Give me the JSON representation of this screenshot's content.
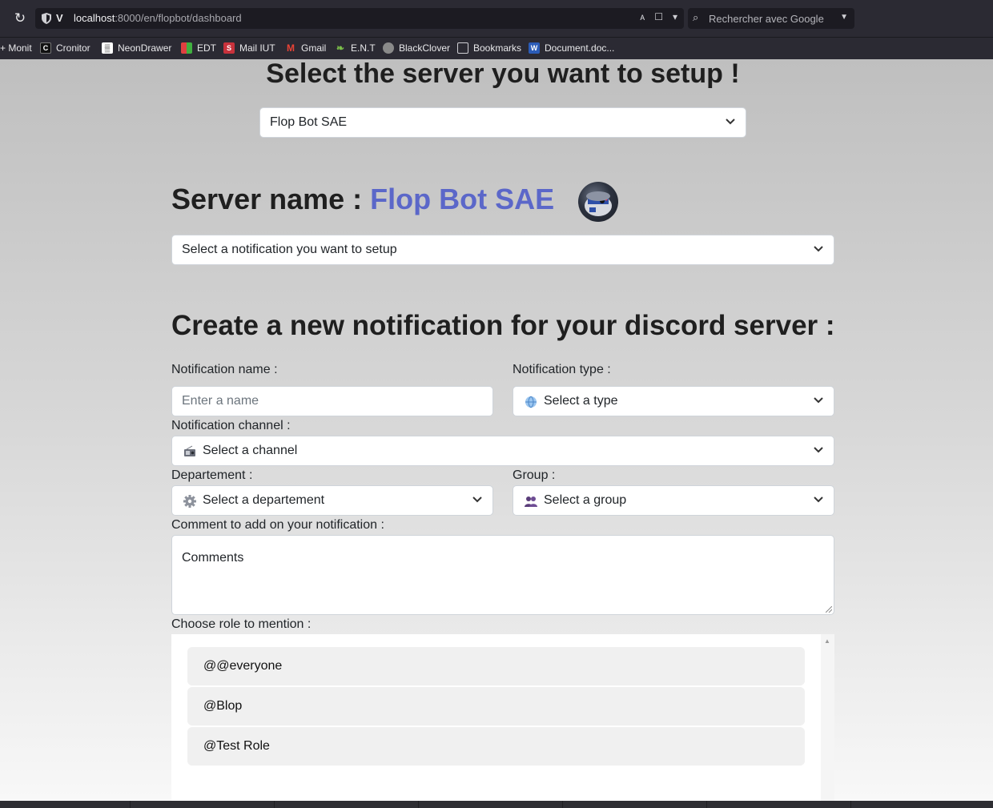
{
  "browser": {
    "url_host": "localhost",
    "url_rest": ":8000/en/flopbot/dashboard",
    "search_placeholder": "Rechercher avec Google",
    "bookmarks": [
      {
        "label": "+ Monit",
        "icon": "none"
      },
      {
        "label": "Cronitor",
        "icon": "cronitor-icon"
      },
      {
        "label": "NeonDrawer",
        "icon": "neondrawer-icon"
      },
      {
        "label": "EDT",
        "icon": "edt-icon"
      },
      {
        "label": "Mail IUT",
        "icon": "mail-iut-icon"
      },
      {
        "label": "Gmail",
        "icon": "gmail-icon"
      },
      {
        "label": "E.N.T",
        "icon": "ent-icon"
      },
      {
        "label": "BlackClover",
        "icon": "blackclover-icon"
      },
      {
        "label": "Bookmarks",
        "icon": "folder-icon"
      },
      {
        "label": "Document.doc...",
        "icon": "word-icon"
      }
    ]
  },
  "page": {
    "select_server_heading": "Select the server you want to setup !",
    "server_select_value": "Flop Bot SAE",
    "server_name_prefix": "Server name : ",
    "server_name": "Flop Bot SAE",
    "notification_select_value": "Select a notification you want to setup",
    "create_heading": "Create a new notification for your discord server :",
    "form": {
      "name_label": "Notification name :",
      "name_placeholder": "Enter a name",
      "type_label": "Notification type :",
      "type_value": "Select a type",
      "channel_label": "Notification channel :",
      "channel_value": "Select a channel",
      "departement_label": "Departement :",
      "departement_value": "Select a departement",
      "group_label": "Group :",
      "group_value": "Select a group",
      "comment_label": "Comment to add on your notification :",
      "comment_placeholder": "Comments",
      "roles_label": "Choose role to mention :",
      "roles": [
        "@@everyone",
        "@Blop",
        "@Test Role"
      ]
    }
  },
  "colors": {
    "accent": "#5b67c9",
    "heading": "#1f1f1f"
  }
}
